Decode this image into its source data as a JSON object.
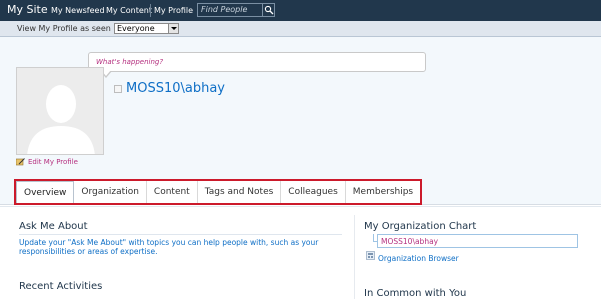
{
  "top_nav": {
    "site_title": "My Site",
    "items": [
      "My Newsfeed",
      "My Content",
      "My Profile"
    ],
    "search_placeholder": "Find People"
  },
  "view_bar": {
    "label": "View My Profile as seen by:",
    "selected": "Everyone"
  },
  "profile": {
    "status_prompt": "What's happening?",
    "username": "MOSS10\\abhay",
    "edit_link": "Edit My Profile"
  },
  "tabs": [
    {
      "label": "Overview",
      "active": true
    },
    {
      "label": "Organization",
      "active": false
    },
    {
      "label": "Content",
      "active": false
    },
    {
      "label": "Tags and Notes",
      "active": false
    },
    {
      "label": "Colleagues",
      "active": false
    },
    {
      "label": "Memberships",
      "active": false
    }
  ],
  "ask_me_about": {
    "heading": "Ask Me About",
    "description": "Update your \"Ask Me About\" with topics you can help people with, such as your responsibilities or areas of expertise."
  },
  "recent_activities": {
    "heading": "Recent Activities"
  },
  "org_chart": {
    "heading": "My Organization Chart",
    "node": "MOSS10\\abhay",
    "browser_link": "Organization Browser"
  },
  "in_common": {
    "heading": "In Common with You"
  },
  "colors": {
    "topbar": "#21374c",
    "link_blue": "#0f6fc6",
    "accent_magenta": "#b5307f",
    "highlight_red": "#cc1a2b"
  }
}
